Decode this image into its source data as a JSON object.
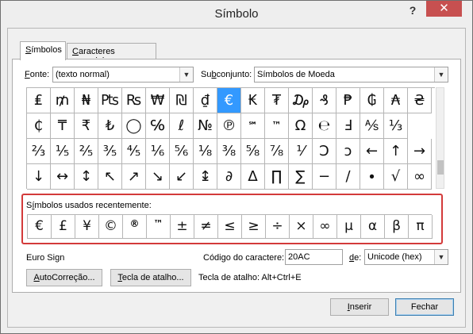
{
  "window": {
    "title": "Símbolo",
    "help": "?",
    "close": "✕"
  },
  "tabs": [
    {
      "label": "Símbolos",
      "hotkey": "S",
      "rest": "ímbolos"
    },
    {
      "label": "Caracteres especiais",
      "pre": "",
      "hotkey": "C",
      "rest": "aracteres especiais"
    }
  ],
  "font": {
    "label_hot": "F",
    "label_rest": "onte:",
    "value": "(texto normal)"
  },
  "subset": {
    "label_pre": "Su",
    "label_hot": "b",
    "label_rest": "conjunto:",
    "value": "Símbolos de Moeda"
  },
  "symbols": [
    [
      "₤",
      "₥",
      "₦",
      "₧",
      "₨",
      "₩",
      "₪",
      "₫",
      "€",
      "₭",
      "₮",
      "₯",
      "₰",
      "₱",
      "₲",
      "₳",
      "₴"
    ],
    [
      "₵",
      "₸",
      "₹",
      "₺",
      "◯",
      "℅",
      "ℓ",
      "№",
      "℗",
      "℠",
      "™",
      "Ω",
      "℮",
      "Ⅎ",
      "⅍",
      "⅓"
    ],
    [
      "⅔",
      "⅕",
      "⅖",
      "⅗",
      "⅘",
      "⅙",
      "⅚",
      "⅛",
      "⅜",
      "⅝",
      "⅞",
      "⅟",
      "Ↄ",
      "ↄ",
      "←",
      "↑",
      "→"
    ],
    [
      "↓",
      "↔",
      "↕",
      "↖",
      "↗",
      "↘",
      "↙",
      "↨",
      "∂",
      "∆",
      "∏",
      "∑",
      "−",
      "∕",
      "∙",
      "√",
      "∞"
    ]
  ],
  "selected_symbol": "€",
  "recent": {
    "label_pre": "S",
    "label_hot": "í",
    "label_rest": "mbolos usados recentemente:",
    "items": [
      "€",
      "£",
      "¥",
      "©",
      "®",
      "™",
      "±",
      "≠",
      "≤",
      "≥",
      "÷",
      "×",
      "∞",
      "µ",
      "α",
      "β",
      "π"
    ]
  },
  "char_name": "Euro Sign",
  "char_code": {
    "label": "Código do caractere:",
    "value": "20AC"
  },
  "from": {
    "label_hot": "d",
    "label_rest": "e:",
    "value": "Unicode (hex)"
  },
  "autocorrect": {
    "hot": "A",
    "rest": "utoCorreção..."
  },
  "shortcut_key": {
    "hot": "T",
    "rest": "ecla de atalho..."
  },
  "shortcut_text": "Tecla de atalho: Alt+Ctrl+E",
  "insert": {
    "hot": "I",
    "rest": "nserir"
  },
  "close_button": "Fechar"
}
